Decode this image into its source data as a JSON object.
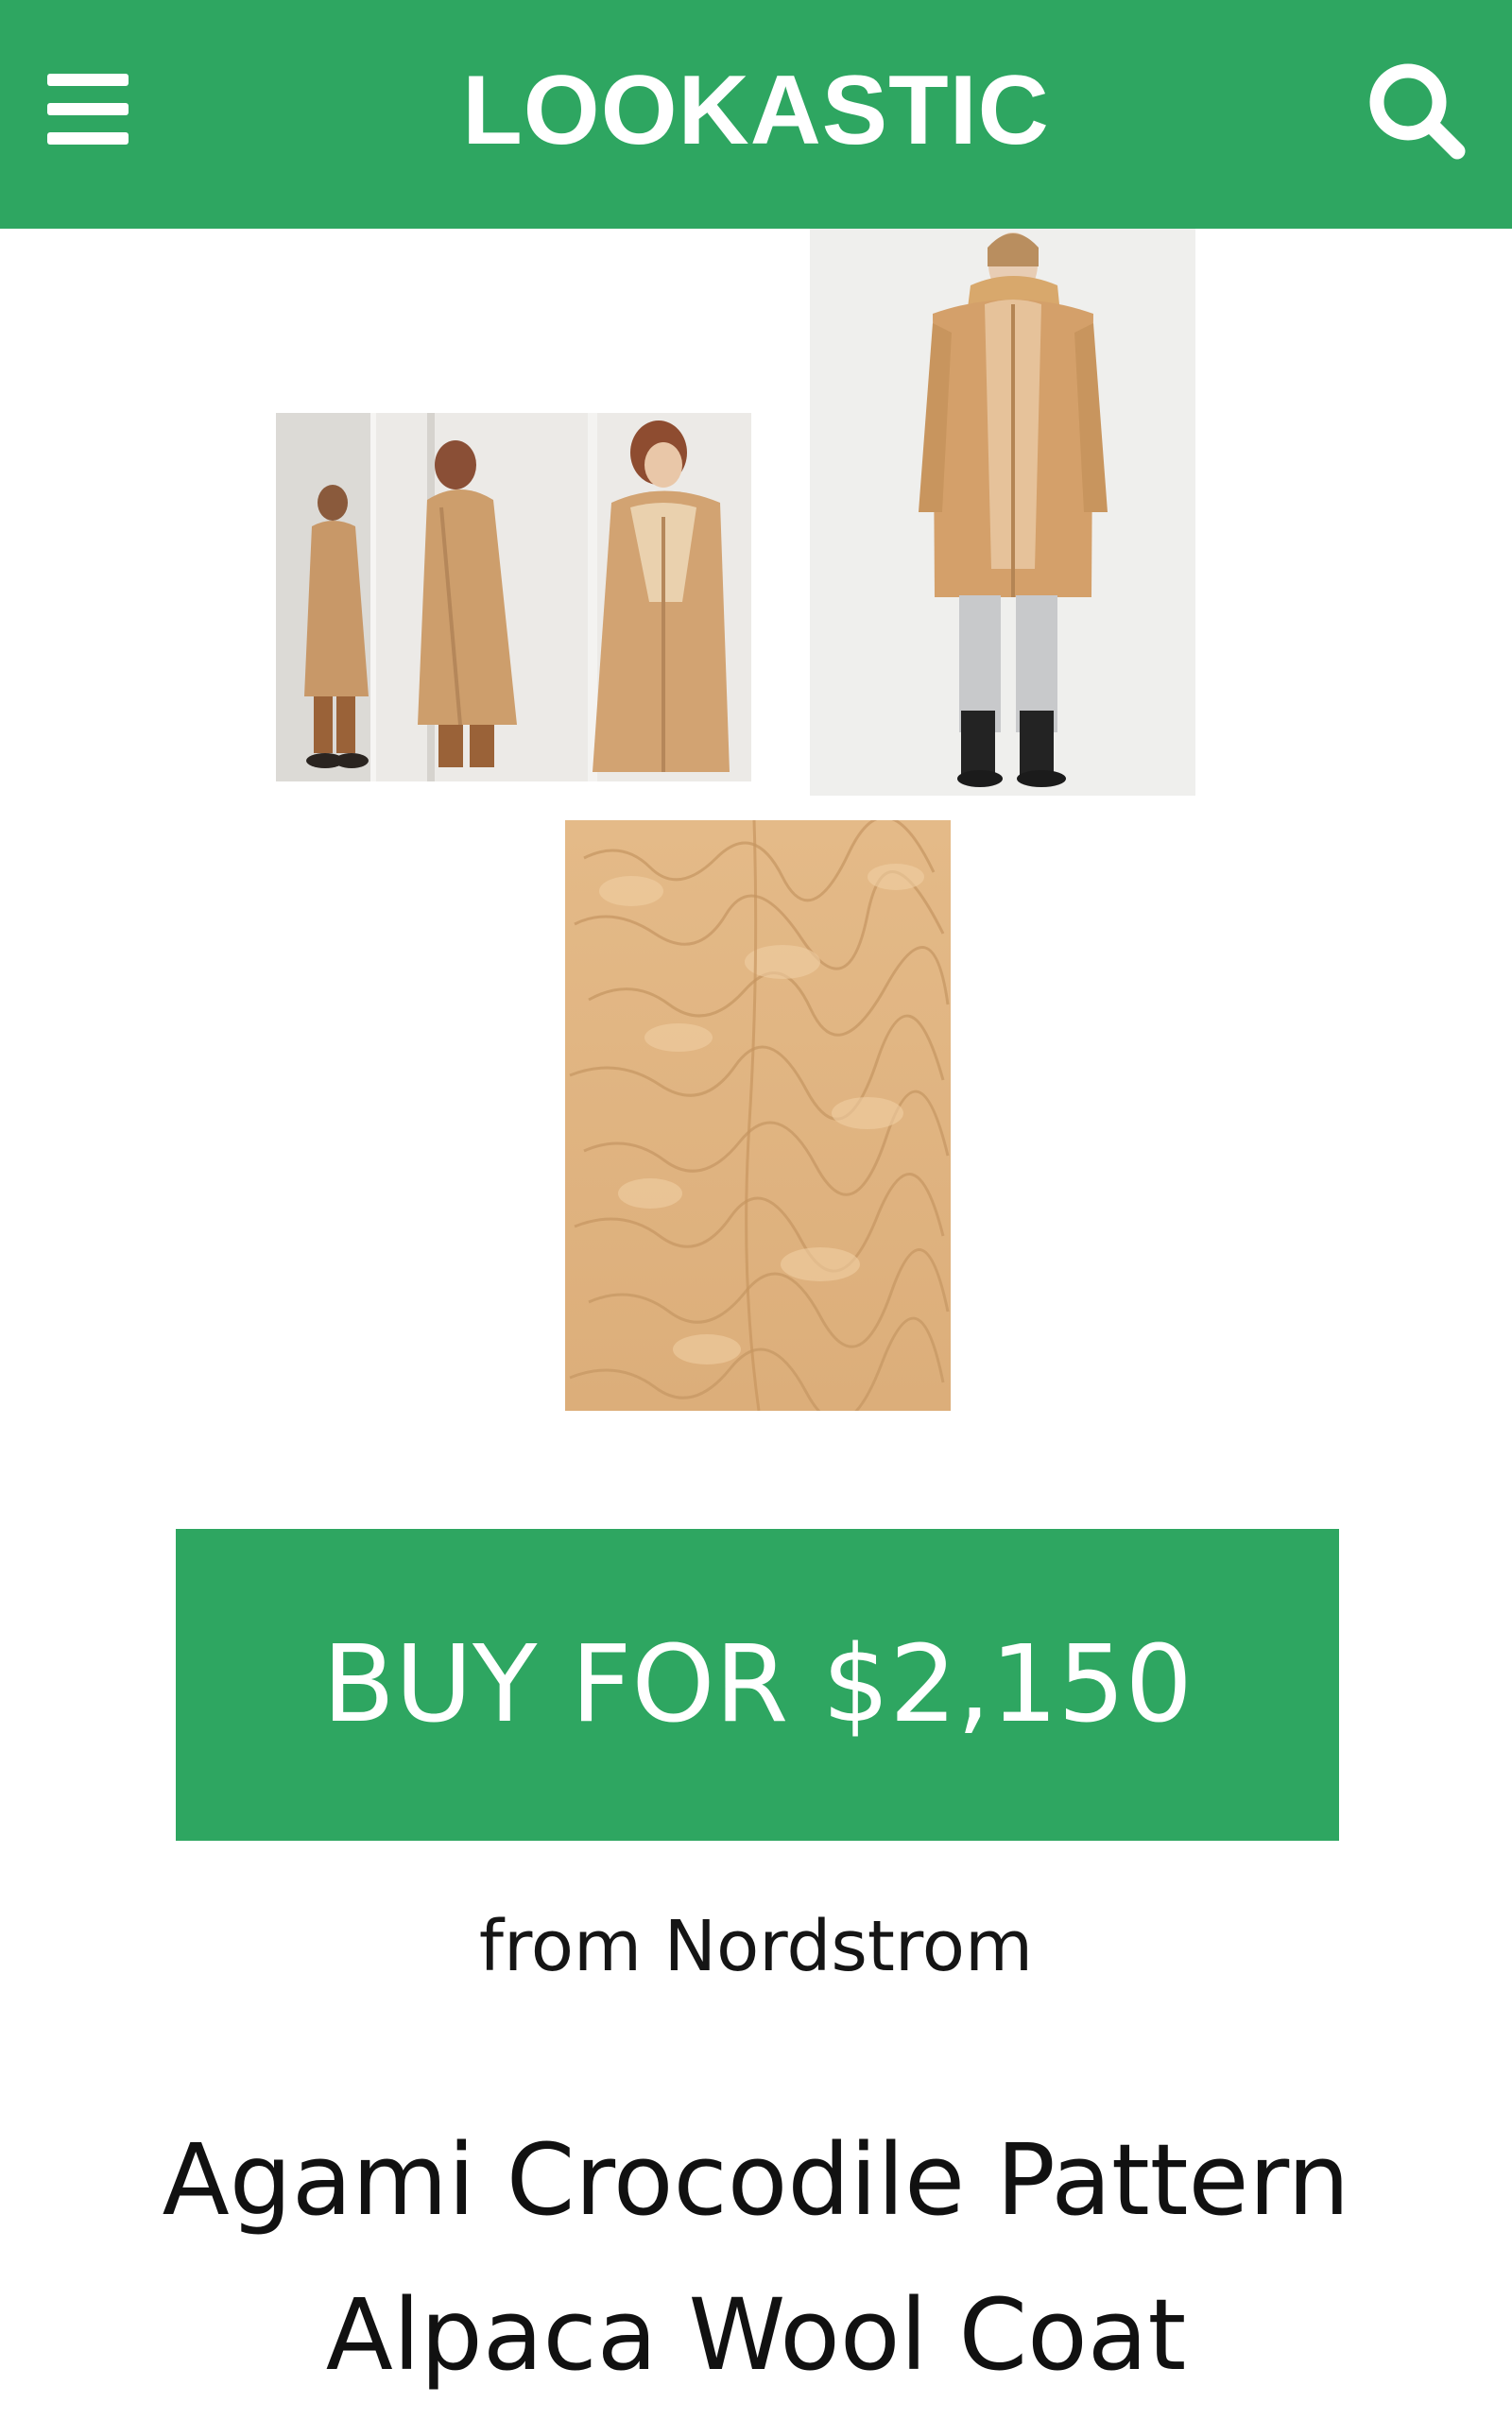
{
  "header": {
    "brand": "LOOKASTIC",
    "menu_icon": "hamburger-menu-icon",
    "search_icon": "search-icon",
    "background_color": "#2ea661"
  },
  "product": {
    "images": [
      {
        "name": "lookbook-three-poses-photo"
      },
      {
        "name": "model-front-view-photo"
      },
      {
        "name": "fabric-texture-closeup-photo"
      }
    ],
    "buy_label": "BUY FOR $2,150",
    "retailer": "from Nordstrom",
    "title": "Agami Crocodile Pattern Alpaca Wool Coat",
    "accent_color": "#2ea661",
    "coat_color": "#d4a06a"
  }
}
